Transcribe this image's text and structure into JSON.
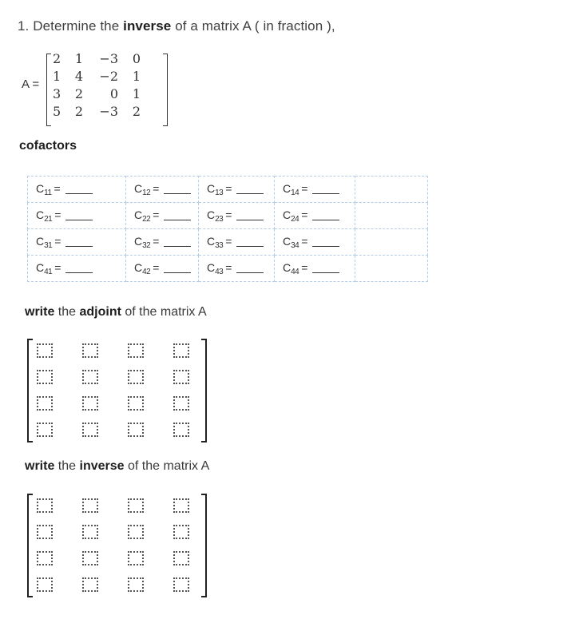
{
  "question": {
    "number": "1.",
    "text_before": "Determine the",
    "bold": "inverse",
    "text_after": "of a matrix A ( in fraction ),"
  },
  "matrix_a": {
    "label": "A =",
    "rows": [
      [
        "2",
        "1",
        "−3",
        "0"
      ],
      [
        "1",
        "4",
        "−2",
        "1"
      ],
      [
        "3",
        "2",
        "0",
        "1"
      ],
      [
        "5",
        "2",
        "−3",
        "2"
      ]
    ]
  },
  "cofactors": {
    "heading": "cofactors",
    "rows": [
      [
        {
          "base": "C",
          "sub": "11"
        },
        {
          "base": "C",
          "sub": "12"
        },
        {
          "base": "C",
          "sub": "13"
        },
        {
          "base": "C",
          "sub": "14"
        }
      ],
      [
        {
          "base": "C",
          "sub": "21"
        },
        {
          "base": "C",
          "sub": "22"
        },
        {
          "base": "C",
          "sub": "23"
        },
        {
          "base": "C",
          "sub": "24"
        }
      ],
      [
        {
          "base": "C",
          "sub": "31"
        },
        {
          "base": "C",
          "sub": "32"
        },
        {
          "base": "C",
          "sub": "33"
        },
        {
          "base": "C",
          "sub": "34"
        }
      ],
      [
        {
          "base": "C",
          "sub": "41"
        },
        {
          "base": "C",
          "sub": "42"
        },
        {
          "base": "C",
          "sub": "43"
        },
        {
          "base": "C",
          "sub": "44"
        }
      ]
    ],
    "equals": "=",
    "values": [
      [
        "",
        "",
        "",
        ""
      ],
      [
        "",
        "",
        "",
        ""
      ],
      [
        "",
        "",
        "",
        ""
      ],
      [
        "",
        "",
        "",
        ""
      ]
    ]
  },
  "adjoint": {
    "bold1": "write",
    "mid": "the",
    "bold2": "adjoint",
    "tail": "of the matrix A",
    "values": [
      [
        "",
        "",
        "",
        ""
      ],
      [
        "",
        "",
        "",
        ""
      ],
      [
        "",
        "",
        "",
        ""
      ],
      [
        "",
        "",
        "",
        ""
      ]
    ]
  },
  "inverse": {
    "bold1": "write",
    "mid": "the",
    "bold2": "inverse",
    "tail": "of the matrix A",
    "values": [
      [
        "",
        "",
        "",
        ""
      ],
      [
        "",
        "",
        "",
        ""
      ],
      [
        "",
        "",
        "",
        ""
      ],
      [
        "",
        "",
        "",
        ""
      ]
    ]
  }
}
